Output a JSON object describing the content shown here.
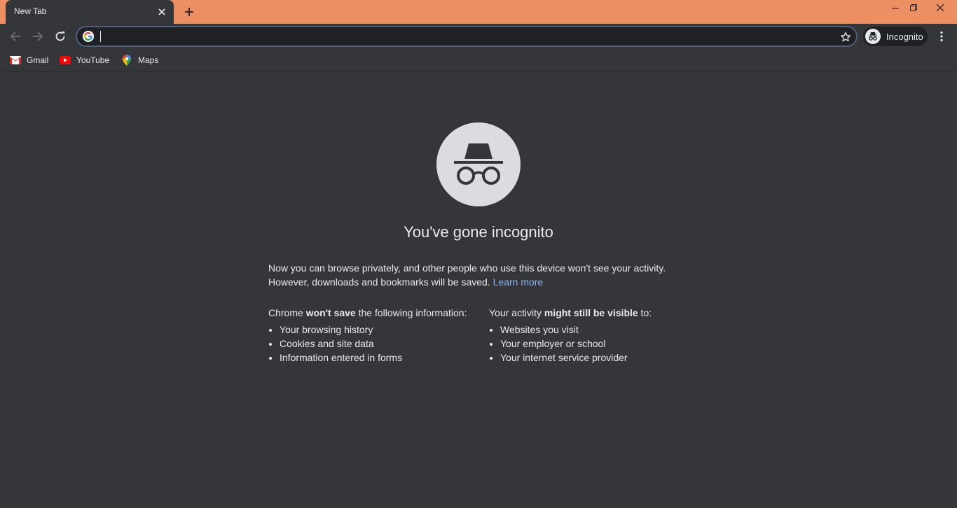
{
  "tab": {
    "title": "New Tab"
  },
  "omnibox": {
    "value": "",
    "placeholder": ""
  },
  "profile": {
    "label": "Incognito"
  },
  "bookmarks": [
    {
      "label": "Gmail",
      "icon": "gmail-icon"
    },
    {
      "label": "YouTube",
      "icon": "youtube-icon"
    },
    {
      "label": "Maps",
      "icon": "maps-icon"
    }
  ],
  "page": {
    "headline": "You've gone incognito",
    "intro": "Now you can browse privately, and other people who use this device won't see your activity. However, downloads and bookmarks will be saved.",
    "learn_more": "Learn more",
    "left": {
      "head_pre": "Chrome ",
      "head_bold": "won't save",
      "head_post": " the following information:",
      "items": [
        "Your browsing history",
        "Cookies and site data",
        "Information entered in forms"
      ]
    },
    "right": {
      "head_pre": "Your activity ",
      "head_bold": "might still be visible",
      "head_post": " to:",
      "items": [
        "Websites you visit",
        "Your employer or school",
        "Your internet service provider"
      ]
    }
  },
  "colors": {
    "titlebar": "#ec8f63",
    "background": "#35363a",
    "link": "#8ab4f8",
    "text": "#e8eaed"
  }
}
